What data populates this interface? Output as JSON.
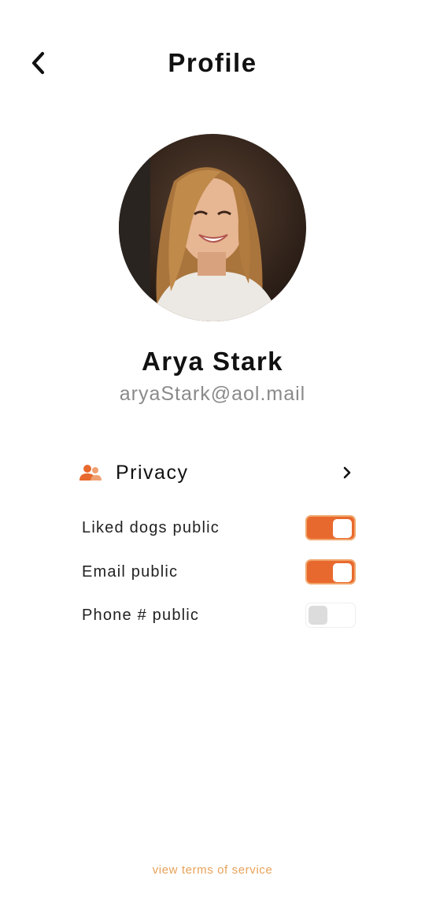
{
  "header": {
    "title": "Profile",
    "back_icon": "chevron-left-icon"
  },
  "profile": {
    "name": "Arya Stark",
    "email": "aryaStark@aol.mail",
    "avatar": "user-photo"
  },
  "privacy": {
    "label": "Privacy",
    "icon": "users-icon",
    "chevron": "chevron-right-icon",
    "settings": [
      {
        "label": "Liked dogs public",
        "enabled": true
      },
      {
        "label": "Email public",
        "enabled": true
      },
      {
        "label": "Phone # public",
        "enabled": false
      }
    ]
  },
  "footer": {
    "terms_link": "view terms of service"
  },
  "colors": {
    "accent": "#e8692e",
    "accent_border": "#f1a76d",
    "link": "#e8a25a",
    "muted_text": "#8a8a8a",
    "toggle_off_knob": "#dcdcdc"
  }
}
